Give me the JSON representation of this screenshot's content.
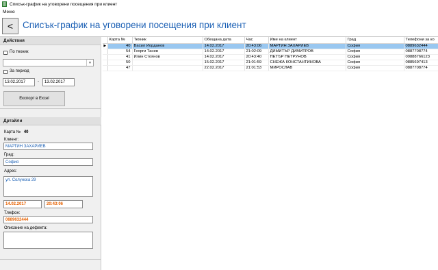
{
  "window": {
    "title": "Списък-график на уговорени посещения при клиент"
  },
  "menu": {
    "items": [
      {
        "label": "Меню"
      }
    ]
  },
  "header": {
    "back_label": "<",
    "title": "Списък-график на уговорени посещения при клиент"
  },
  "actions": {
    "heading": "Действия",
    "by_technician_label": "По техник",
    "technician_value": "",
    "by_period_label": "За период",
    "date_from": "13.02.2017",
    "date_sep": "-",
    "date_to": "13.02.2017",
    "export_label": "Експорт в Excel"
  },
  "details": {
    "heading": "Дртайли",
    "card_label": "Карта №",
    "card_value": "40",
    "client_label": "Клиент:",
    "client_value": "МАРТИН ЗАХАРИЕВ",
    "city_label": "Град:",
    "city_value": "София",
    "address_label": "Адрес:",
    "address_value": "ул. Солунска 29",
    "date_value": "14.02.2017",
    "time_value": "20:43:06",
    "phone_label": "Тлефон:",
    "phone_value": "0889632444",
    "defect_label": "Описание на дефекта:",
    "defect_value": ""
  },
  "table": {
    "columns": [
      "Карта №",
      "Техник",
      "Обещана дата",
      "Час",
      "Име на клиент",
      "Град",
      "Телефони за ко"
    ],
    "rows": [
      [
        "40",
        "Васил Йорданов",
        "14.02.2017",
        "20:43:06",
        "МАРТИН ЗАХАРИЕВ",
        "София",
        "0889632444"
      ],
      [
        "54",
        "Георги Танев",
        "14.02.2017",
        "21:02:09",
        "ДИМИТЪР ДИМИТРОВ",
        "София",
        "0887708774"
      ],
      [
        "41",
        "Илин Стоянов",
        "14.02.2017",
        "20:43:40",
        "ПЕТЪР ПЕТРУНОВ",
        "София",
        "09888766123"
      ],
      [
        "50",
        "",
        "15.02.2017",
        "21:01:59",
        "СНЕЖА КОНСТАНТИНОВА",
        "София",
        "0885697413"
      ],
      [
        "47",
        "",
        "22.02.2017",
        "21:01:53",
        "МИРОСЛАВ",
        "София",
        "0887708774"
      ]
    ],
    "selected_row_marker": "▶",
    "selected_index": 0
  },
  "colors": {
    "accent": "#1a5fb4",
    "selection": "#99c7f0",
    "highlight": "#e66100"
  }
}
